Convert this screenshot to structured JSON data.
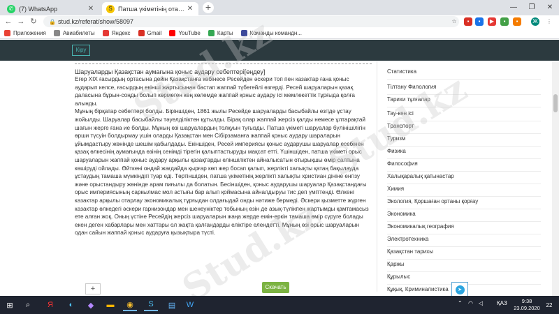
{
  "browser": {
    "tabs": [
      {
        "title": "(7) WhatsApp",
        "favicon_color": "#25d366",
        "favicon_glyph": "✆",
        "icon": "whatsapp-icon",
        "active": false
      },
      {
        "title": "Патша үкіметінің отаршылдық",
        "favicon_color": "#f7c600",
        "favicon_glyph": "S",
        "icon": "stud-icon",
        "active": true
      }
    ],
    "new_tab_label": "+",
    "url": "stud.kz/referat/show/58097",
    "bookmarks": [
      {
        "label": "Приложения",
        "icon": "apps-icon",
        "color": "#e94235"
      },
      {
        "label": "Авиабилеты",
        "icon": "plane-icon",
        "color": "#888888"
      },
      {
        "label": "Яндекс",
        "icon": "yandex-icon",
        "color": "#e53935"
      },
      {
        "label": "Gmail",
        "icon": "gmail-icon",
        "color": "#d93025"
      },
      {
        "label": "YouTube",
        "icon": "youtube-icon",
        "color": "#ff0000"
      },
      {
        "label": "Карты",
        "icon": "maps-icon",
        "color": "#34a853"
      },
      {
        "label": "Команды командн...",
        "icon": "commands-icon",
        "color": "#3c4a9b"
      }
    ]
  },
  "site": {
    "login_label": "Кіру",
    "heading": "Шаруаларды Қазақстан аумағына қоныс аудару себептері[өңдеу]",
    "paragraphs": [
      "Егер XIX ғасырдың ортасына дейін Қазақстанға көбінесе Ресейден әскери топ пен казактар ғана қоныс аударып келсе, ғасырдың екінші жартысынан бастап жаппай түбегейлі өзгерді. Ресей шаруаларын қазақ даласына бұрын-соңды болып көрмеген кең көлемде жаппай қоныс аудару ісі мемлекеттік тұрғыда қолға алынды.",
      "Мұның бірқатар себептері болды. Біріншіден, 1861 жылы Ресейде шаруаларды басыбайлы езгіде ұстау жойылды. Шаруалар басыбайлы тәуелділіктен құтылды. Бірақ олар жаппай жерсіз қалды немесе ұлтарақтай шағын жерге ғана ие болды. Мұның өзі шаруалардың толқуын туғызды. Патша үкіметі шаруалар бүлінішілігін өрши түсуін болдырмау үшін оларды Қазақстан мен Сібірзаманға жаппай қоныс аудару шараларын ұйымдастыру жөнінде шешім қабылдады. Екіншіден, Ресей империясы қоныс аударушы шаруалар есебінен қазақ өлкесінің аумағында өзінің сенімді тірегін қалыптастыруды мақсат етті. Үшіншіден, патша үкіметі орыс шаруаларын жаппай қоныс аудару арқылы қазақтарды еліншіліктен айналысатын отырықшы өмір салтына көшіруді ойлады. Өйткені ондай жағдайда қырғар көп жер босап қалып, жерлікті халықты қатаң бақылауда ұстаудың тамаша мүмкіндігі туар еді. Төртіншіден, патша үкіметінің жерлікті халықты христиан дініне енгізу және орыстандыру жөнінде арам пиғылы да болатын. Бесіншіден, қоныс аударушы шаруалар Қазақстандағы орыс империясының саркылмас мол астығы бар алып қоймасына айналдыруы тис деп үміттенді. Өлкені казактар арқылы отарлау экономикалық тұрғыдан олдағыдай онды нәтиже бермеді. Әскери қызметте жүрген казактар өлкедегі әскери гарнизондар мен шенеуніктер тобының өзін де азық-түлікпен жартымды қамтамасыз ете алған жоқ. Оның үстіне Ресейдің жерсіз шаруаларын жаңа жерде емін-еркін тамаша өмір сүруге болады екен деген хабарлары мен хаттары ол жақта қалғандарды еліктіре елендетті. Мұның өзі орыс шаруаларын одан сайын жаппай қоныс аударуға қызықтыра түсті."
    ],
    "download_label": "Скачать",
    "plus_label": "+",
    "sidebar_items": [
      "Статистика",
      "Тілтану Филология",
      "Тарихи тұлғалар",
      "Тау-кен ісі",
      "Транспорт",
      "Туризм",
      "Физика",
      "Философия",
      "Халықаралық қатынастар",
      "Химия",
      "Экология, Қоршаған ортаны қорғау",
      "Экономика",
      "Экономикалық география",
      "Электротехника",
      "Қазақстан тарихы",
      "Қаржы",
      "Құрылыс",
      "Құқық, Криминалистика"
    ],
    "watermark": "Stud.kz"
  },
  "taskbar": {
    "language": "ҚАЗ",
    "time": "9:38",
    "date": "23.09.2020",
    "notification_count": "22"
  },
  "colors": {
    "header_bg": "#2c3a3f",
    "accent": "#49b3b0",
    "download": "#7cb342",
    "taskbar": "#1f2430"
  }
}
